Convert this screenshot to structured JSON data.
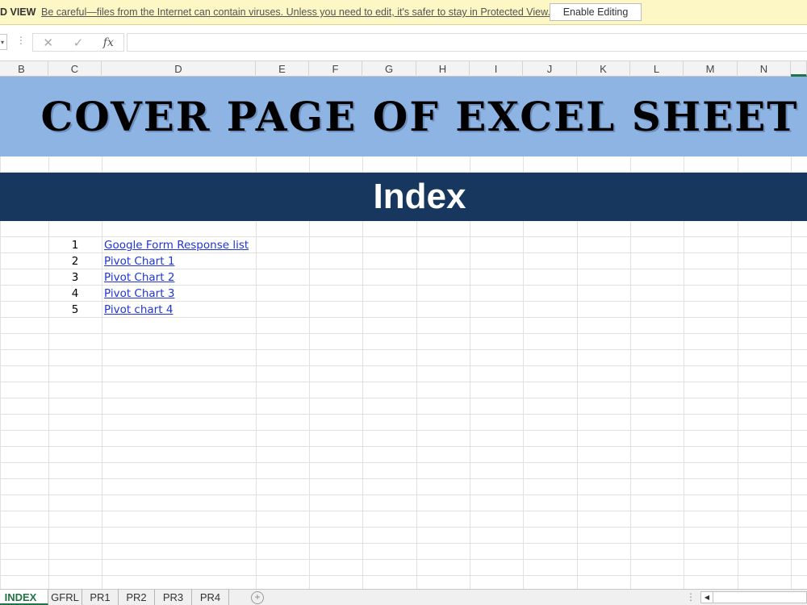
{
  "protected_view": {
    "label": "D VIEW",
    "message": "Be careful—files from the Internet can contain viruses. Unless you need to edit, it's safer to stay in Protected View.",
    "enable_button": "Enable Editing"
  },
  "formula_bar": {
    "cancel_icon": "✕",
    "confirm_icon": "✓",
    "fx_label": "fx",
    "value": ""
  },
  "columns": [
    "B",
    "C",
    "D",
    "E",
    "F",
    "G",
    "H",
    "I",
    "J",
    "K",
    "L",
    "M",
    "N"
  ],
  "sheet": {
    "cover_title": "COVER PAGE OF EXCEL SHEET",
    "index_title": "Index",
    "index_items": [
      {
        "num": "1",
        "label": "Google Form Response list"
      },
      {
        "num": "2",
        "label": "Pivot Chart 1"
      },
      {
        "num": "3",
        "label": "Pivot Chart 2"
      },
      {
        "num": "4",
        "label": "Pivot Chart 3"
      },
      {
        "num": "5",
        "label": "Pivot chart 4"
      }
    ]
  },
  "tabs": [
    "INDEX",
    "GFRL",
    "PR1",
    "PR2",
    "PR3",
    "PR4"
  ],
  "active_tab": "INDEX",
  "colors": {
    "title_band": "#8eb4e3",
    "index_band": "#17375e",
    "link": "#1f35d4",
    "active_tab": "#217346",
    "protected_bar": "#fdf6c5"
  }
}
